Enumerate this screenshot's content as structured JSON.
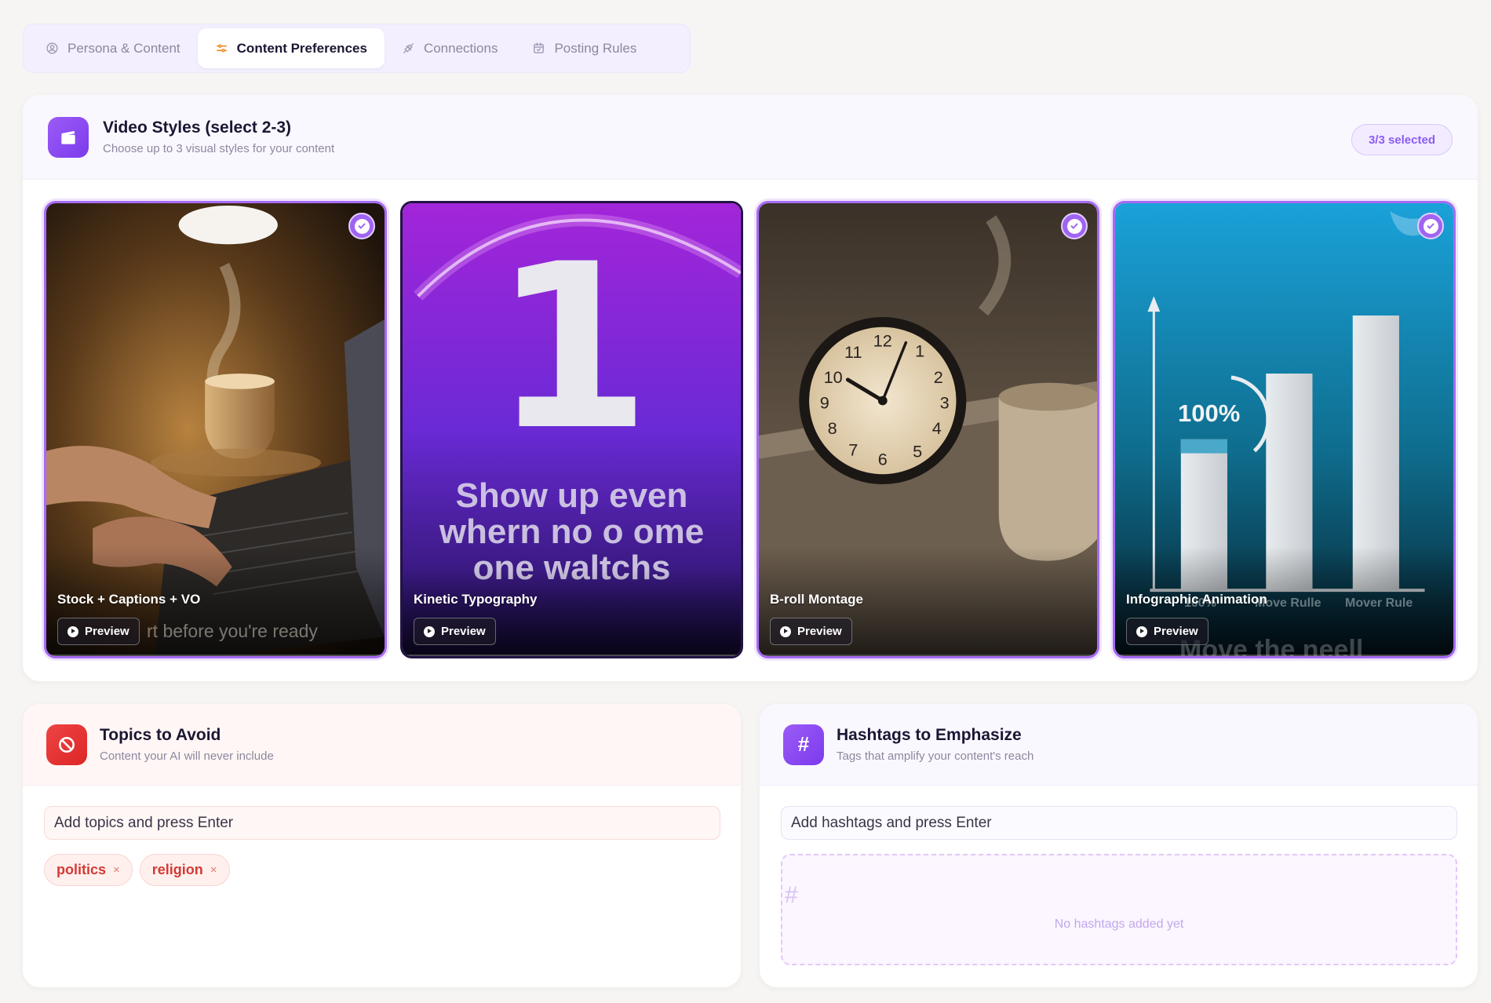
{
  "tabs": [
    {
      "label": "Persona & Content",
      "icon": "user-circle-icon"
    },
    {
      "label": "Content Preferences",
      "icon": "sliders-icon",
      "active": true
    },
    {
      "label": "Connections",
      "icon": "plug-icon"
    },
    {
      "label": "Posting Rules",
      "icon": "calendar-icon"
    }
  ],
  "video_styles": {
    "title": "Video Styles (select 2-3)",
    "subtitle": "Choose up to 3 visual styles for your content",
    "selected_badge": "3/3 selected",
    "preview_label": "Preview",
    "cards": [
      {
        "label": "Stock + Captions + VO",
        "selected": true,
        "overlay_text": "rt before you're ready"
      },
      {
        "label": "Kinetic Typography",
        "selected": false,
        "big_number": "1",
        "line1": "Show up even",
        "line2": "whern no o ome",
        "line3": "one waltchs"
      },
      {
        "label": "B-roll Montage",
        "selected": true
      },
      {
        "label": "Infographic Animation",
        "selected": true,
        "percent": "100%",
        "axis_label_1": "100%",
        "axis_label_2": "Move Rulle",
        "axis_label_3": "Mover Rule",
        "overlay_text": "Move the neell"
      }
    ]
  },
  "topics_to_avoid": {
    "title": "Topics to Avoid",
    "subtitle": "Content your AI will never include",
    "placeholder": "Add topics and press Enter",
    "chips": [
      "politics",
      "religion"
    ],
    "remove_symbol": "×"
  },
  "hashtags": {
    "title": "Hashtags to Emphasize",
    "subtitle": "Tags that amplify your content's reach",
    "icon_symbol": "#",
    "placeholder": "Add hashtags and press Enter",
    "empty_symbol": "#",
    "empty_text": "No hashtags added yet"
  },
  "colors": {
    "accent": "#8b5cf6",
    "danger": "#dc2626",
    "background": "#f6f5f3"
  }
}
